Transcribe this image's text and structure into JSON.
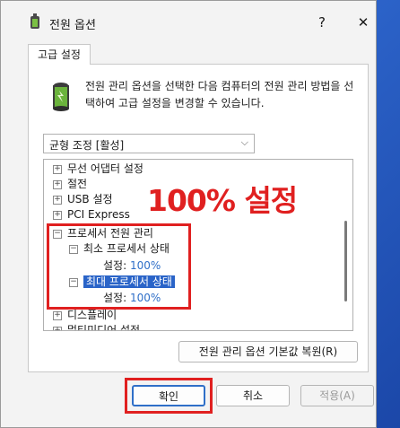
{
  "window": {
    "title": "전원 옵션",
    "help_glyph": "?",
    "close_glyph": "✕",
    "icon": "power-options-icon"
  },
  "tab": {
    "label": "고급 설정"
  },
  "panel": {
    "icon": "battery-icon",
    "description": "전원 관리 옵션을 선택한 다음 컴퓨터의 전원 관리 방법을 선택하여 고급 설정을 변경할 수 있습니다."
  },
  "plan_select": {
    "value": "균형 조정 [활성]",
    "chevron_icon": "chevron-down-icon"
  },
  "tree": {
    "items": [
      {
        "expander": "+",
        "label": "무선 어댑터 설정"
      },
      {
        "expander": "+",
        "label": "절전"
      },
      {
        "expander": "+",
        "label": "USB 설정"
      },
      {
        "expander": "+",
        "label": "PCI Express"
      },
      {
        "expander": "−",
        "label": "프로세서 전원 관리"
      },
      {
        "expander": "−",
        "label": "최소 프로세서 상태"
      },
      {
        "label_prefix": "설정:",
        "value": "100%"
      },
      {
        "expander": "−",
        "label": "최대 프로세서 상태",
        "selected": true
      },
      {
        "label_prefix": "설정:",
        "value": "100%"
      },
      {
        "expander": "+",
        "label": "디스플레이"
      },
      {
        "expander": "+",
        "label": "멀티미디어 설정"
      }
    ]
  },
  "annotation": {
    "text": "100% 설정",
    "color": "#e02020"
  },
  "buttons": {
    "restore_label": "전원 관리 옵션 기본값 복원(R)",
    "ok_label": "확인",
    "cancel_label": "취소",
    "apply_label": "적용(A)"
  },
  "colors": {
    "accent": "#2a64c8",
    "value": "#2f6fc8"
  }
}
